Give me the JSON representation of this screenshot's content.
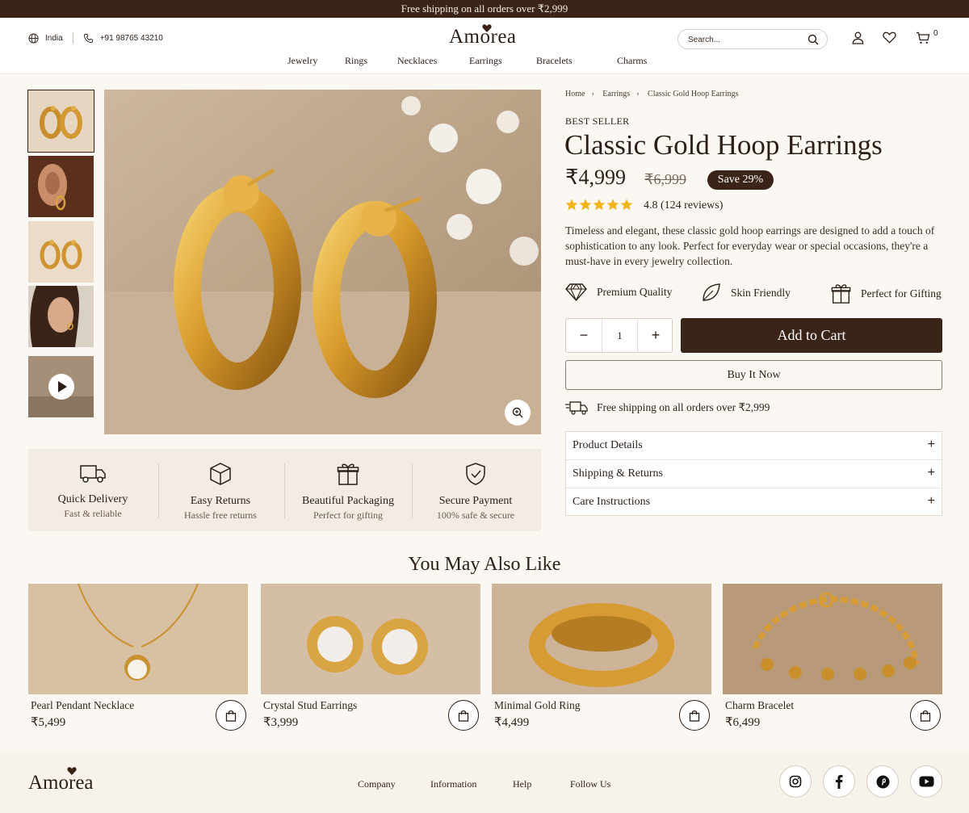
{
  "banner": {
    "text": "Free shipping on all orders over ₹2,999"
  },
  "header": {
    "country": "India",
    "phone": "+91 98765 43210",
    "logo": "Amorea",
    "search_placeholder": "Search...",
    "cart_count": "0",
    "nav": [
      "Jewelry",
      "Rings",
      "Necklaces",
      "Earrings",
      "Bracelets",
      "Charms"
    ]
  },
  "breadcrumb": [
    "Home",
    "Earrings",
    "Classic Gold Hoop Earrings"
  ],
  "product": {
    "tag": "BEST SELLER",
    "title": "Classic Gold Hoop Earrings",
    "price": "₹4,999",
    "old_price": "₹6,999",
    "save": "Save 29%",
    "rating": 5,
    "rating_text": "4.8 (124 reviews)",
    "description": "Timeless and elegant, these classic gold hoop earrings are designed to add a touch of sophistication to any look. Perfect for everyday wear or special occasions, they're a must-have in every jewelry collection.",
    "usps": [
      "Premium Quality",
      "Skin Friendly",
      "Perfect for Gifting"
    ],
    "quantity": "1",
    "qty_minus": "−",
    "qty_plus": "+",
    "add_to_cart": "Add to Cart",
    "buy_now": "Buy It Now",
    "shipping_note": "Free shipping on all orders over ₹2,999",
    "accordion": [
      "Product Details",
      "Shipping & Returns",
      "Care Instructions"
    ],
    "accordion_icon": "+"
  },
  "features": [
    {
      "title": "Quick Delivery",
      "subtitle": "Fast & reliable",
      "icon": "truck-icon"
    },
    {
      "title": "Easy Returns",
      "subtitle": "Hassle free returns",
      "icon": "box-icon"
    },
    {
      "title": "Beautiful Packaging",
      "subtitle": "Perfect for gifting",
      "icon": "gift-icon"
    },
    {
      "title": "Secure Payment",
      "subtitle": "100% safe & secure",
      "icon": "shield-icon"
    }
  ],
  "related": {
    "title": "You May Also Like",
    "items": [
      {
        "name": "Pearl Pendant Necklace",
        "price": "₹5,499"
      },
      {
        "name": "Crystal Stud Earrings",
        "price": "₹3,999"
      },
      {
        "name": "Minimal Gold Ring",
        "price": "₹4,499"
      },
      {
        "name": "Charm Bracelet",
        "price": "₹6,499"
      }
    ]
  },
  "footer": {
    "logo": "Amorea",
    "links": [
      "Company",
      "Information",
      "Help",
      "Follow Us"
    ],
    "social": [
      "instagram-icon",
      "facebook-icon",
      "pinterest-icon",
      "youtube-icon"
    ]
  },
  "colors": {
    "brand": "#3a2418",
    "gold": "#c98f2a",
    "star": "#f2b31b",
    "background": "#fbf8f4"
  }
}
